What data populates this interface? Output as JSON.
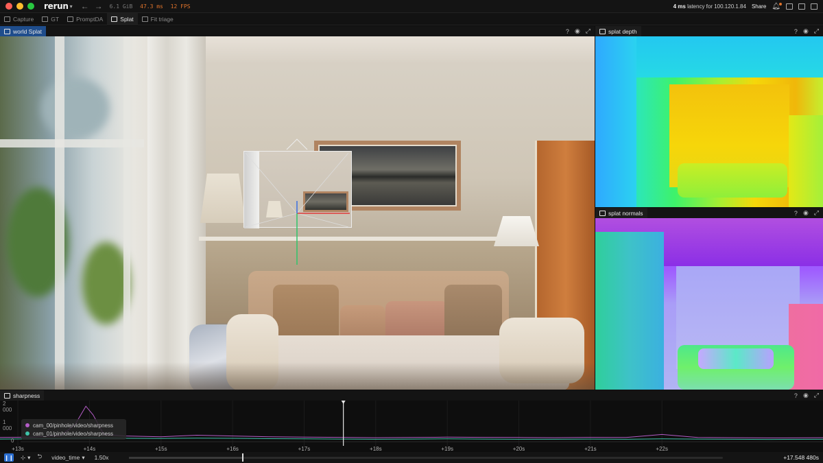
{
  "titlebar": {
    "app_name": "rerun",
    "memory": "6.1 GiB",
    "frame_time": "47.3 ms",
    "fps": "12 FPS",
    "latency_value": "4 ms",
    "latency_text": "latency for 100.120.1.84",
    "share_label": "Share",
    "colors": {
      "close": "#ff5f57",
      "minimize": "#febc2e",
      "zoom": "#28c840",
      "perf_warn": "#e0732b"
    }
  },
  "tabs": [
    {
      "label": "Capture",
      "active": false
    },
    {
      "label": "GT",
      "active": false
    },
    {
      "label": "PromptDA",
      "active": false
    },
    {
      "label": "Splat",
      "active": true
    },
    {
      "label": "Fit triage",
      "active": false
    }
  ],
  "panels": {
    "world": {
      "title": "world Splat"
    },
    "depth": {
      "title": "splat depth"
    },
    "normals": {
      "title": "splat normals"
    },
    "sharpness": {
      "title": "sharpness"
    }
  },
  "panel_controls": {
    "help": "?",
    "visibility": "eye-icon",
    "maximize": "expand-icon"
  },
  "chart_data": {
    "type": "line",
    "title": "sharpness",
    "ylim": [
      0,
      2000
    ],
    "yticks": [
      "2 000",
      "1 000",
      "0"
    ],
    "xlim": [
      12.75,
      24.25
    ],
    "xticks": [
      "+13s",
      "+14s",
      "+15s",
      "+16s",
      "+17s",
      "+18s",
      "+19s",
      "+20s",
      "+21s",
      "+22s"
    ],
    "cursor_time_s": 17.548,
    "series": [
      {
        "name": "cam_00/pinhole/video/sharpness",
        "color": "#b45cc7",
        "x": [
          12.75,
          13.2,
          13.6,
          13.8,
          13.95,
          14.05,
          14.2,
          14.5,
          15.0,
          15.5,
          16.0,
          16.5,
          17.0,
          17.5,
          18.0,
          18.5,
          19.0,
          19.5,
          20.0,
          20.5,
          21.0,
          21.5,
          22.0,
          22.5,
          23.0,
          23.5,
          24.25
        ],
        "values": [
          220,
          240,
          320,
          900,
          1850,
          1400,
          380,
          300,
          260,
          340,
          300,
          260,
          240,
          230,
          210,
          220,
          240,
          230,
          220,
          210,
          230,
          220,
          380,
          220,
          210,
          200,
          210
        ]
      },
      {
        "name": "cam_01/pinhole/video/sharpness",
        "color": "#3fc3a9",
        "x": [
          12.75,
          13.5,
          14.0,
          14.5,
          15.0,
          15.5,
          16.0,
          16.5,
          17.0,
          17.5,
          18.0,
          18.5,
          19.0,
          19.5,
          20.0,
          20.5,
          21.0,
          21.5,
          22.0,
          22.5,
          23.0,
          23.5,
          24.25
        ],
        "values": [
          140,
          160,
          200,
          180,
          170,
          190,
          180,
          160,
          150,
          140,
          130,
          140,
          150,
          140,
          130,
          130,
          140,
          130,
          150,
          140,
          130,
          120,
          130
        ]
      }
    ]
  },
  "timeline": {
    "timeline_name": "video_time",
    "speed": "1.50x",
    "current_time": "+17.548 480s",
    "progress": 0.19
  }
}
